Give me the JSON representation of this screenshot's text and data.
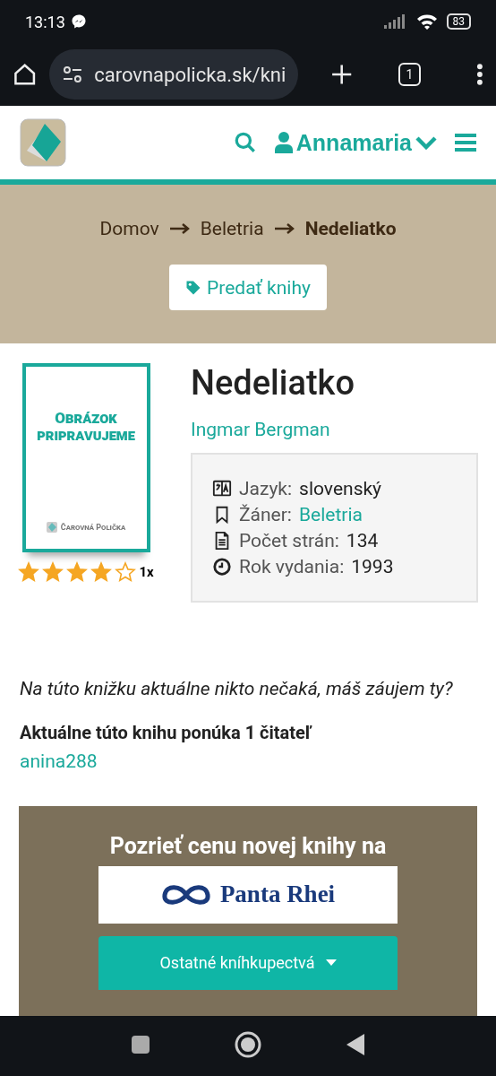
{
  "status_bar": {
    "time": "13:13",
    "battery": "83"
  },
  "browser": {
    "url": "carovnapolicka.sk/kni",
    "tab_count": "1"
  },
  "header": {
    "user": "Annamaria"
  },
  "breadcrumb": [
    {
      "label": "Domov",
      "current": false
    },
    {
      "label": "Beletria",
      "current": false
    },
    {
      "label": "Nedeliatko",
      "current": true
    }
  ],
  "sell_button": "Predať knihy",
  "book": {
    "cover_title": "Obrázok pripravujeme",
    "cover_brand": "Čarovná Polička",
    "stars": 4,
    "rating_count": "1x",
    "title": "Nedeliatko",
    "author": "Ingmar Bergman",
    "details": [
      {
        "kind": "language",
        "label": "Jazyk:",
        "value": "slovenský",
        "link": false
      },
      {
        "kind": "genre",
        "label": "Žáner:",
        "value": "Beletria",
        "link": true
      },
      {
        "kind": "pages",
        "label": "Počet strán:",
        "value": "134",
        "link": false
      },
      {
        "kind": "year",
        "label": "Rok vydania:",
        "value": "1993",
        "link": false
      }
    ]
  },
  "waiting_note": "Na túto knižku aktuálne nikto nečaká, máš záujem ty?",
  "offer": {
    "heading": "Aktuálne túto knihu ponúka 1 čitateľ",
    "users": [
      "anina288"
    ]
  },
  "promo": {
    "heading": "Pozrieť cenu novej knihy na",
    "store": "Panta Rhei",
    "dropdown": "Ostatné kníhkupectvá"
  }
}
